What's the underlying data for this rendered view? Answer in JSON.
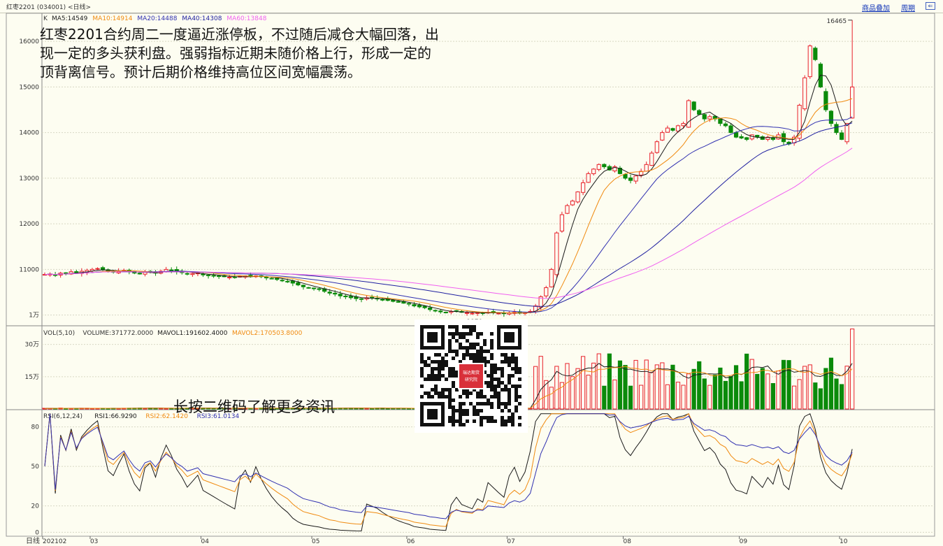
{
  "header": {
    "title": "红枣2201 (034001) <日线>",
    "link_overlay": "商品叠加",
    "link_period": "周期",
    "btn_icon": "restore-window-icon"
  },
  "commentary": "红枣2201合约周二一度逼近涨停板，不过随后减仓大幅回落，出现一定的多头获利盘。强弱指标近期未随价格上行，形成一定的顶背离信号。预计后期价格维持高位区间宽幅震荡。",
  "qr_caption": "长按二维码了解更多资讯",
  "qr_badge": [
    "瑞达期货",
    "研究院"
  ],
  "colors": {
    "up": "#e8202a",
    "down": "#0a8a0a",
    "ma5": "#1a1a1a",
    "ma10": "#f08a10",
    "ma20": "#3030b0",
    "ma40": "#2020a0",
    "ma60": "#f060f0"
  },
  "chart_data": [
    {
      "type": "candlestick",
      "panel": "price",
      "k_label": "K",
      "legend": [
        {
          "name": "MA5",
          "value": "14549",
          "color": "#1a1a1a"
        },
        {
          "name": "MA10",
          "value": "14914",
          "color": "#f08a10"
        },
        {
          "name": "MA20",
          "value": "14488",
          "color": "#3030b0"
        },
        {
          "name": "MA40",
          "value": "14308",
          "color": "#2020a0"
        },
        {
          "name": "MA60",
          "value": "13848",
          "color": "#f060f0"
        }
      ],
      "yticks": [
        {
          "v": 16000,
          "label": "16000"
        },
        {
          "v": 15000,
          "label": "15000"
        },
        {
          "v": 14000,
          "label": "14000"
        },
        {
          "v": 13000,
          "label": "13000"
        },
        {
          "v": 12000,
          "label": "12000"
        },
        {
          "v": 11000,
          "label": "11000"
        },
        {
          "v": 10000,
          "label": "1万"
        }
      ],
      "ylim": [
        9780,
        16600
      ],
      "annotations": [
        {
          "label": "16465",
          "v": 16465
        },
        {
          "label": "9870",
          "v": 9870
        }
      ],
      "closes": [
        10890,
        10900,
        10880,
        10920,
        10910,
        10950,
        10930,
        10960,
        10980,
        11000,
        11020,
        10990,
        10950,
        10940,
        10960,
        10980,
        10950,
        10920,
        10900,
        10940,
        10950,
        10920,
        10960,
        11000,
        10980,
        10950,
        10930,
        10900,
        10910,
        10920,
        10880,
        10870,
        10860,
        10850,
        10840,
        10830,
        10820,
        10850,
        10860,
        10840,
        10860,
        10840,
        10820,
        10800,
        10780,
        10760,
        10740,
        10700,
        10660,
        10620,
        10600,
        10580,
        10560,
        10520,
        10480,
        10460,
        10420,
        10400,
        10380,
        10360,
        10350,
        10380,
        10370,
        10360,
        10340,
        10320,
        10300,
        10280,
        10260,
        10240,
        10200,
        10180,
        10160,
        10120,
        10100,
        10070,
        10050,
        10080,
        10090,
        10060,
        10050,
        10040,
        10050,
        10040,
        10060,
        10050,
        10040,
        10030,
        10050,
        10060,
        10040,
        10050,
        10080,
        10200,
        10400,
        10600,
        11000,
        11800,
        12200,
        12400,
        12500,
        12700,
        12900,
        13100,
        13200,
        13300,
        13250,
        13180,
        13250,
        13100,
        13000,
        12950,
        13050,
        13150,
        13300,
        13550,
        13800,
        14000,
        14100,
        14050,
        14150,
        14200,
        14700,
        14500,
        14400,
        14300,
        14350,
        14300,
        14200,
        14150,
        14000,
        13900,
        13880,
        13850,
        13950,
        13900,
        13850,
        13900,
        13850,
        13950,
        13800,
        13750,
        13900,
        14600,
        15200,
        15900,
        15600,
        15000,
        14500,
        14200,
        14000,
        13850,
        14200,
        15000
      ],
      "vol": {
        "legend": [
          {
            "name": "VOL(5,10)",
            "value": "",
            "color": "#333333"
          },
          {
            "name": "VOLUME",
            "value": "371772.0000",
            "color": "#333333"
          },
          {
            "name": "MAVOL1",
            "value": "191602.4000",
            "color": "#1a1a1a"
          },
          {
            "name": "MAVOL2",
            "value": "170503.8000",
            "color": "#f08a10"
          }
        ],
        "yticks": [
          {
            "v": 300000,
            "label": "30万"
          },
          {
            "v": 150000,
            "label": "15万"
          }
        ],
        "ylim": [
          0,
          380000
        ]
      },
      "rsi": {
        "legend": [
          {
            "name": "RSI(6,12,24)",
            "value": "",
            "color": "#333333"
          },
          {
            "name": "RSI1",
            "value": "66.9290",
            "color": "#1a1a1a"
          },
          {
            "name": "RSI2",
            "value": "62.1420",
            "color": "#f08a10"
          },
          {
            "name": "RSI3",
            "value": "61.0134",
            "color": "#3030b0"
          }
        ],
        "yticks": [
          {
            "v": 80,
            "label": "80"
          },
          {
            "v": 50,
            "label": "50"
          },
          {
            "v": 20,
            "label": "20"
          },
          {
            "v": 0,
            "label": "0"
          }
        ],
        "ylim": [
          -3,
          92
        ]
      },
      "x_period_label": "日线",
      "x_ticks": [
        {
          "i": 0,
          "label": "202102"
        },
        {
          "i": 9,
          "label": "03"
        },
        {
          "i": 30,
          "label": "04"
        },
        {
          "i": 51,
          "label": "05"
        },
        {
          "i": 69,
          "label": "06"
        },
        {
          "i": 88,
          "label": "07"
        },
        {
          "i": 110,
          "label": "08"
        },
        {
          "i": 132,
          "label": "09"
        },
        {
          "i": 151,
          "label": "10"
        }
      ]
    }
  ]
}
